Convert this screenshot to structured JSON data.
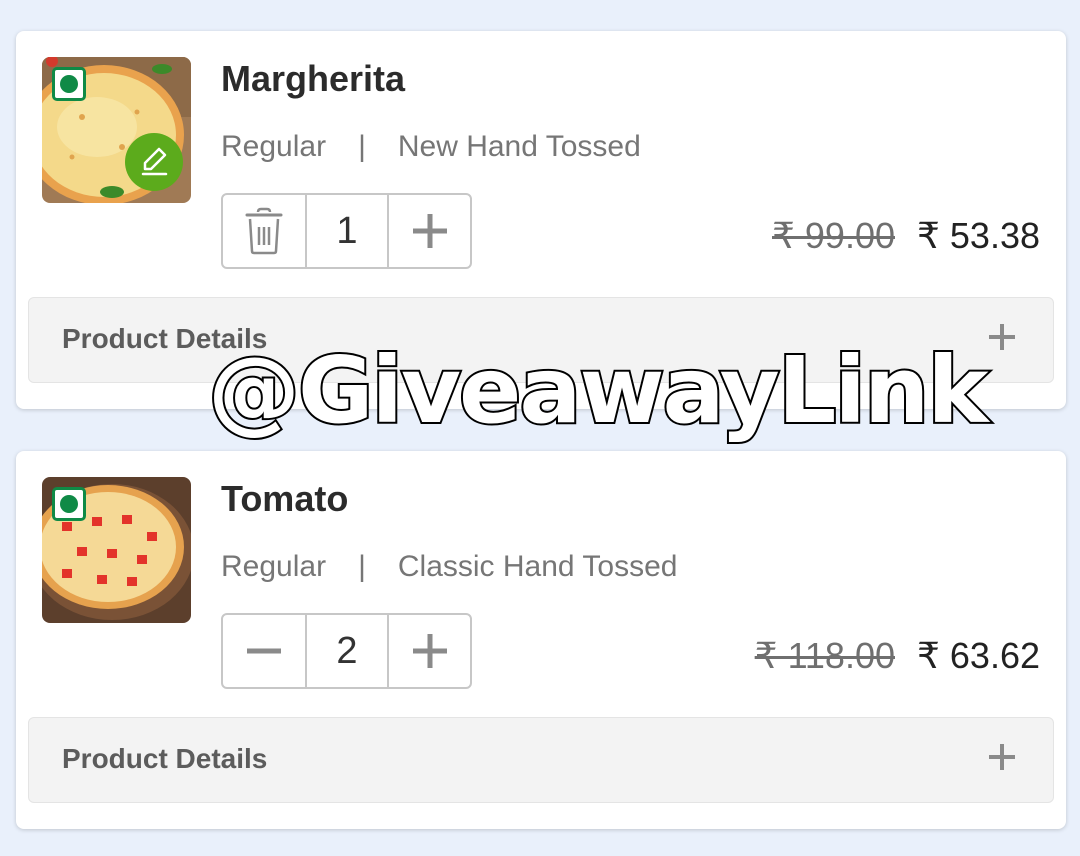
{
  "items": [
    {
      "name": "Margherita",
      "size": "Regular",
      "separator": "|",
      "crust": "New Hand Tossed",
      "quantity": "1",
      "old_price": "₹ 99.00",
      "price": "₹ 53.38",
      "details_label": "Product Details",
      "left_action_icon": "trash-icon",
      "badge_icon": "edit-icon"
    },
    {
      "name": "Tomato",
      "size": "Regular",
      "separator": "|",
      "crust": "Classic Hand Tossed",
      "quantity": "2",
      "old_price": "₹ 118.00",
      "price": "₹ 63.62",
      "details_label": "Product Details",
      "left_action_icon": "minus-icon"
    }
  ],
  "watermark": "@GiveawayLink",
  "colors": {
    "veg_green": "#0f8a46",
    "edit_green": "#5cab1c",
    "background": "#e9f0fb"
  }
}
